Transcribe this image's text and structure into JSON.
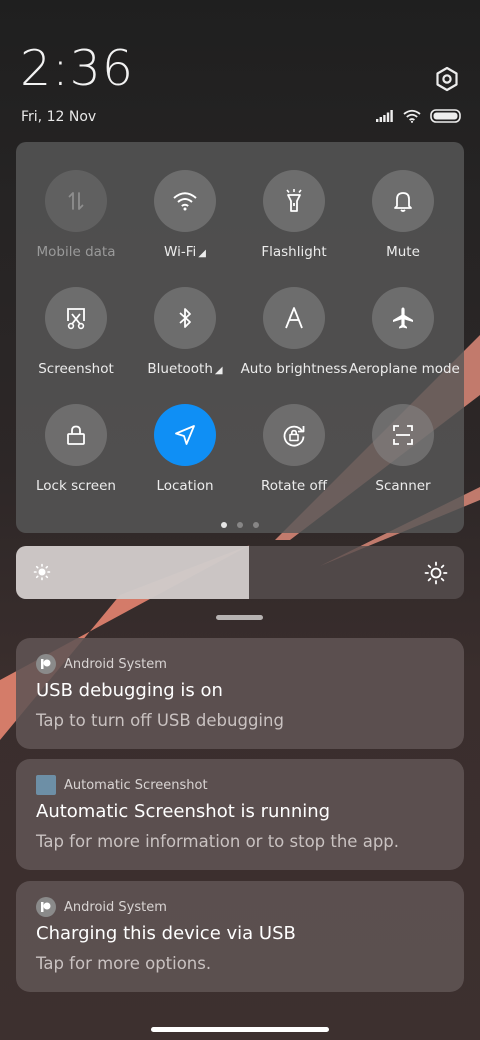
{
  "status": {
    "time": "2:36",
    "date": "Fri, 12 Nov"
  },
  "quick_settings": {
    "tiles": [
      {
        "label": "Mobile data",
        "icon": "mobile-data-icon",
        "state": "disabled",
        "has_caret": false
      },
      {
        "label": "Wi-Fi",
        "icon": "wifi-icon",
        "state": "on",
        "has_caret": true
      },
      {
        "label": "Flashlight",
        "icon": "flashlight-icon",
        "state": "off",
        "has_caret": false
      },
      {
        "label": "Mute",
        "icon": "bell-icon",
        "state": "off",
        "has_caret": false
      },
      {
        "label": "Screenshot",
        "icon": "screenshot-icon",
        "state": "off",
        "has_caret": false
      },
      {
        "label": "Bluetooth",
        "icon": "bluetooth-icon",
        "state": "off",
        "has_caret": true
      },
      {
        "label": "Auto brightness",
        "icon": "auto-brightness-icon",
        "state": "off",
        "has_caret": false
      },
      {
        "label": "Aeroplane mode",
        "icon": "airplane-icon",
        "state": "off",
        "has_caret": false
      },
      {
        "label": "Lock screen",
        "icon": "lock-icon",
        "state": "off",
        "has_caret": false
      },
      {
        "label": "Location",
        "icon": "location-icon",
        "state": "active",
        "has_caret": false
      },
      {
        "label": "Rotate off",
        "icon": "rotate-lock-icon",
        "state": "off",
        "has_caret": false
      },
      {
        "label": "Scanner",
        "icon": "scanner-icon",
        "state": "off",
        "has_caret": false
      }
    ],
    "page_count": 3,
    "current_page": 1
  },
  "brightness": {
    "level": 0.52
  },
  "notifications": [
    {
      "app": "Android System",
      "app_icon": "android-system-icon",
      "title": "USB debugging is on",
      "text": "Tap to turn off USB debugging"
    },
    {
      "app": "Automatic Screenshot",
      "app_icon": "automatic-screenshot-icon",
      "title": "Automatic Screenshot is running",
      "text": "Tap for more information or to stop the app."
    },
    {
      "app": "Android System",
      "app_icon": "android-system-icon",
      "title": "Charging this device via USB",
      "text": "Tap for more options."
    }
  ],
  "colors": {
    "accent": "#0f8ff5",
    "wallpaper_shape": "#f08a74"
  }
}
